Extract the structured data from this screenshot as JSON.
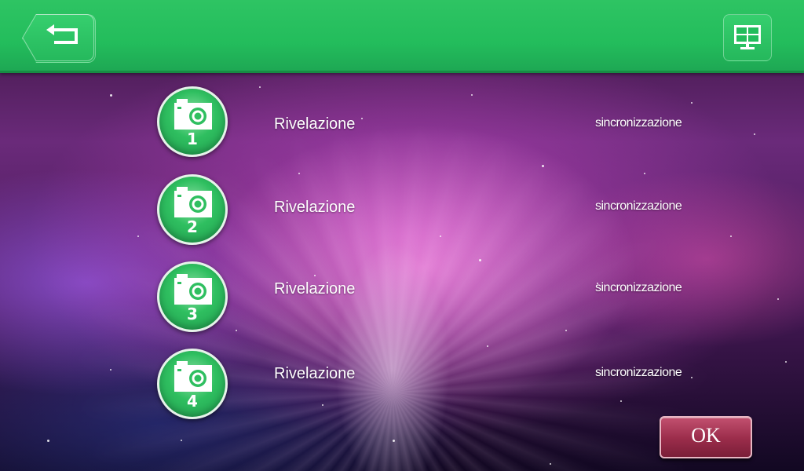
{
  "colors": {
    "topbar": "#23bd5c",
    "camera_button": "#2fbf60",
    "ok_button": "#9a2c4a",
    "text": "#ffffff"
  },
  "header": {
    "back_icon": "back-arrow-icon",
    "menu_icon": "grid-screen-icon"
  },
  "cameras": [
    {
      "number": "1",
      "icon": "camera-icon",
      "label": "Rivelazione",
      "action": "sincronizzazione"
    },
    {
      "number": "2",
      "icon": "camera-icon",
      "label": "Rivelazione",
      "action": "sincronizzazione"
    },
    {
      "number": "3",
      "icon": "camera-icon",
      "label": "Rivelazione",
      "action": "sincronizzazione"
    },
    {
      "number": "4",
      "icon": "camera-icon",
      "label": "Rivelazione",
      "action": "sincronizzazione"
    }
  ],
  "footer": {
    "ok_label": "OK"
  }
}
